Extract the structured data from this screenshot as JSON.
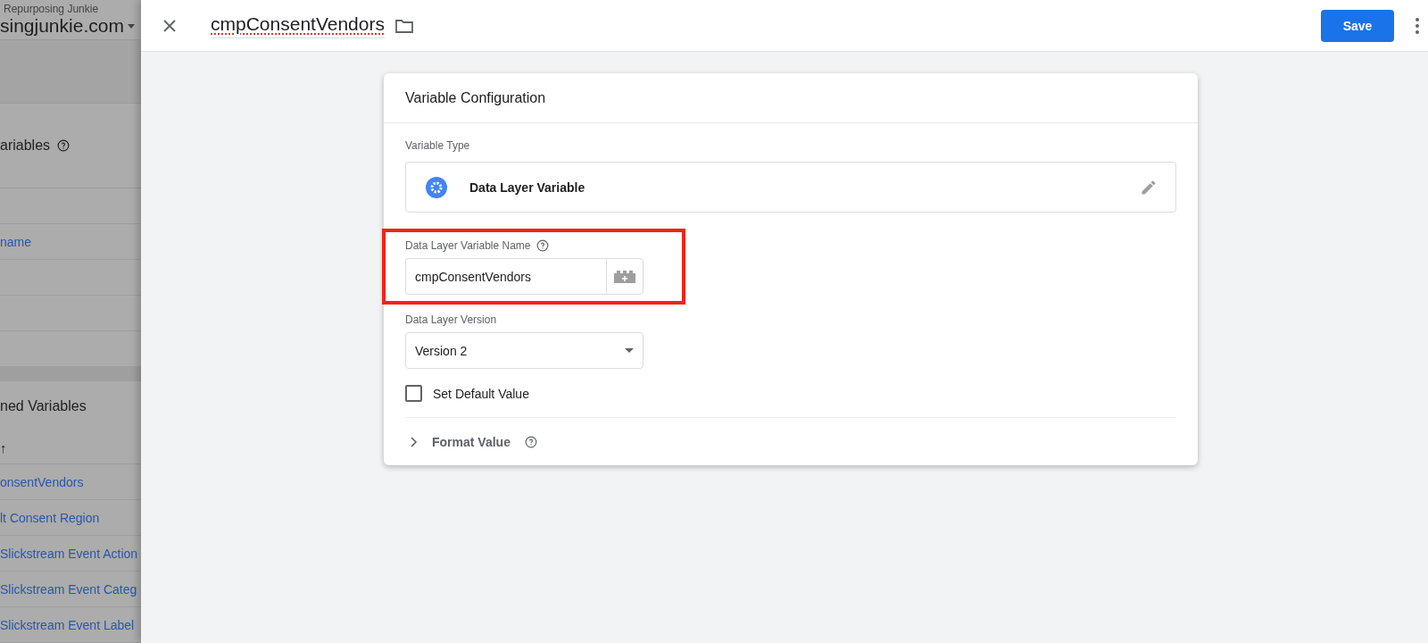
{
  "background_panel": {
    "account": "Repurposing Junkie",
    "container": "singjunkie.com",
    "builtin_title": "ariables",
    "builtin_rows": [
      "name"
    ],
    "user_title": "ned Variables",
    "sort_arrow": "↑",
    "user_rows": [
      "onsentVendors",
      "lt Consent Region",
      "Slickstream Event Action",
      "Slickstream Event Categ",
      "Slickstream Event Label"
    ]
  },
  "editor": {
    "title": "cmpConsentVendors",
    "save": "Save",
    "card": {
      "title": "Variable Configuration",
      "type_label": "Variable Type",
      "type_name": "Data Layer Variable",
      "name_label": "Data Layer Variable Name",
      "name_value": "cmpConsentVendors",
      "version_label": "Data Layer Version",
      "version_value": "Version 2",
      "default_label": "Set Default Value",
      "default_checked": false,
      "format_label": "Format Value",
      "format_expanded": false
    }
  }
}
